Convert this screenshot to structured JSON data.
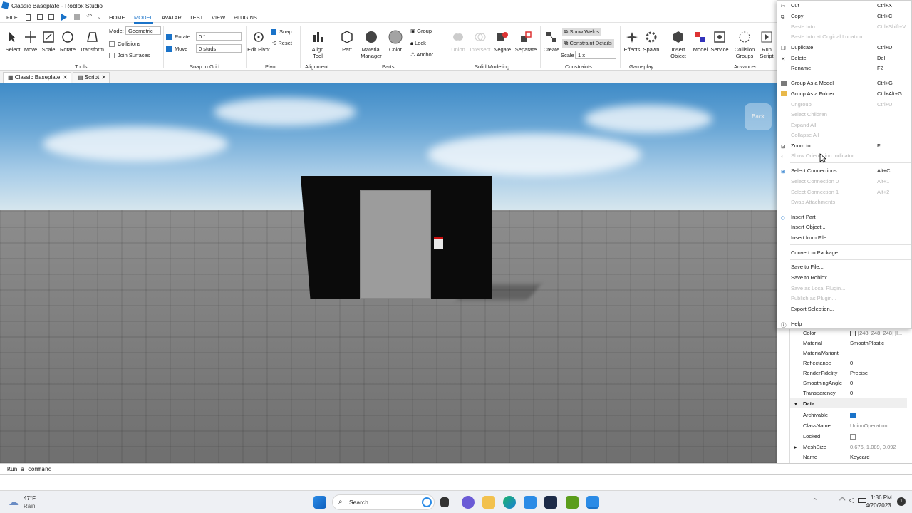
{
  "app": {
    "title": "Classic Baseplate - Roblox Studio"
  },
  "menu_tabs": [
    "FILE",
    "HOME",
    "MODEL",
    "AVATAR",
    "TEST",
    "VIEW",
    "PLUGINS"
  ],
  "ribbon": {
    "tools": {
      "select": "Select",
      "move": "Move",
      "scale": "Scale",
      "rotate": "Rotate",
      "transform": "Transform",
      "group": "Tools"
    },
    "mode_label": "Mode:",
    "mode_value": "Geometric",
    "collisions": "Collisions",
    "join_surfaces": "Join Surfaces",
    "rotate_label": "Rotate",
    "rotate_value": "0 °",
    "move_label": "Move",
    "move_value": "0 studs",
    "snap_group": "Snap to Grid",
    "edit_pivot": "Edit Pivot",
    "snap": "Snap",
    "reset": "Reset",
    "pivot_group": "Pivot",
    "align_tool": "Align Tool",
    "alignment_group": "Alignment",
    "part": "Part",
    "material_manager": "Material Manager",
    "color": "Color",
    "group": "Group",
    "lock": "Lock",
    "anchor": "Anchor",
    "parts_group": "Parts",
    "union": "Union",
    "intersect": "Intersect",
    "negate": "Negate",
    "separate": "Separate",
    "solid_group": "Solid Modeling",
    "create": "Create",
    "show_welds": "Show Welds",
    "constraint_details": "Constraint Details",
    "scale_label": "Scale",
    "scale_value": "1 x",
    "constraints_group": "Constraints",
    "effects": "Effects",
    "spawn": "Spawn",
    "gameplay_group": "Gameplay",
    "insert_object": "Insert Object",
    "model": "Model",
    "service": "Service",
    "collision_groups": "Collision Groups",
    "run_script": "Run Script",
    "advanced_group": "Advanced"
  },
  "doc_tabs": [
    "Classic Baseplate",
    "Script"
  ],
  "viewport": {
    "back": "Back"
  },
  "context_menu": [
    {
      "label": "Cut",
      "shortcut": "Ctrl+X",
      "enabled": true
    },
    {
      "label": "Copy",
      "shortcut": "Ctrl+C",
      "enabled": true
    },
    {
      "label": "Paste Into",
      "shortcut": "Ctrl+Shift+V",
      "enabled": false
    },
    {
      "label": "Paste Into at Original Location",
      "shortcut": "",
      "enabled": false
    },
    {
      "label": "Duplicate",
      "shortcut": "Ctrl+D",
      "enabled": true
    },
    {
      "label": "Delete",
      "shortcut": "Del",
      "enabled": true
    },
    {
      "label": "Rename",
      "shortcut": "F2",
      "enabled": true
    },
    {
      "label": "Group As a Model",
      "shortcut": "Ctrl+G",
      "enabled": true
    },
    {
      "label": "Group As a Folder",
      "shortcut": "Ctrl+Alt+G",
      "enabled": true
    },
    {
      "label": "Ungroup",
      "shortcut": "Ctrl+U",
      "enabled": false
    },
    {
      "label": "Select Children",
      "shortcut": "",
      "enabled": false
    },
    {
      "label": "Expand All",
      "shortcut": "",
      "enabled": false
    },
    {
      "label": "Collapse All",
      "shortcut": "",
      "enabled": false
    },
    {
      "label": "Zoom to",
      "shortcut": "F",
      "enabled": true
    },
    {
      "label": "Show Orientation Indicator",
      "shortcut": "",
      "enabled": false
    },
    {
      "label": "Select Connections",
      "shortcut": "Alt+C",
      "enabled": true
    },
    {
      "label": "Select Connection 0",
      "shortcut": "Alt+1",
      "enabled": false
    },
    {
      "label": "Select Connection 1",
      "shortcut": "Alt+2",
      "enabled": false
    },
    {
      "label": "Swap Attachments",
      "shortcut": "",
      "enabled": false
    },
    {
      "label": "Insert Part",
      "shortcut": "",
      "enabled": true
    },
    {
      "label": "Insert Object...",
      "shortcut": "",
      "enabled": true
    },
    {
      "label": "Insert from File...",
      "shortcut": "",
      "enabled": true
    },
    {
      "label": "Convert to Package...",
      "shortcut": "",
      "enabled": true
    },
    {
      "label": "Save to File...",
      "shortcut": "",
      "enabled": true
    },
    {
      "label": "Save to Roblox...",
      "shortcut": "",
      "enabled": true
    },
    {
      "label": "Save as Local Plugin...",
      "shortcut": "",
      "enabled": false
    },
    {
      "label": "Publish as Plugin...",
      "shortcut": "",
      "enabled": false
    },
    {
      "label": "Export Selection...",
      "shortcut": "",
      "enabled": true
    },
    {
      "label": "Help",
      "shortcut": "",
      "enabled": true
    }
  ],
  "properties": {
    "rows": [
      {
        "k": "Color",
        "v": "[248, 248, 248] [l..."
      },
      {
        "k": "Material",
        "v": "SmoothPlastic"
      },
      {
        "k": "MaterialVariant",
        "v": ""
      },
      {
        "k": "Reflectance",
        "v": "0"
      },
      {
        "k": "RenderFidelity",
        "v": "Precise"
      },
      {
        "k": "SmoothingAngle",
        "v": "0"
      },
      {
        "k": "Transparency",
        "v": "0"
      }
    ],
    "data_group": "Data",
    "data_rows": [
      {
        "k": "Archivable",
        "v": ""
      },
      {
        "k": "ClassName",
        "v": "UnionOperation"
      },
      {
        "k": "Locked",
        "v": ""
      },
      {
        "k": "MeshSize",
        "v": "0.676, 1.089, 0.092"
      },
      {
        "k": "Name",
        "v": "Keycard"
      }
    ]
  },
  "command_bar": {
    "placeholder": "Run a command"
  },
  "taskbar": {
    "weather_temp": "47°F",
    "weather_desc": "Rain",
    "search": "Search",
    "time": "1:36 PM",
    "date": "4/20/2023"
  }
}
